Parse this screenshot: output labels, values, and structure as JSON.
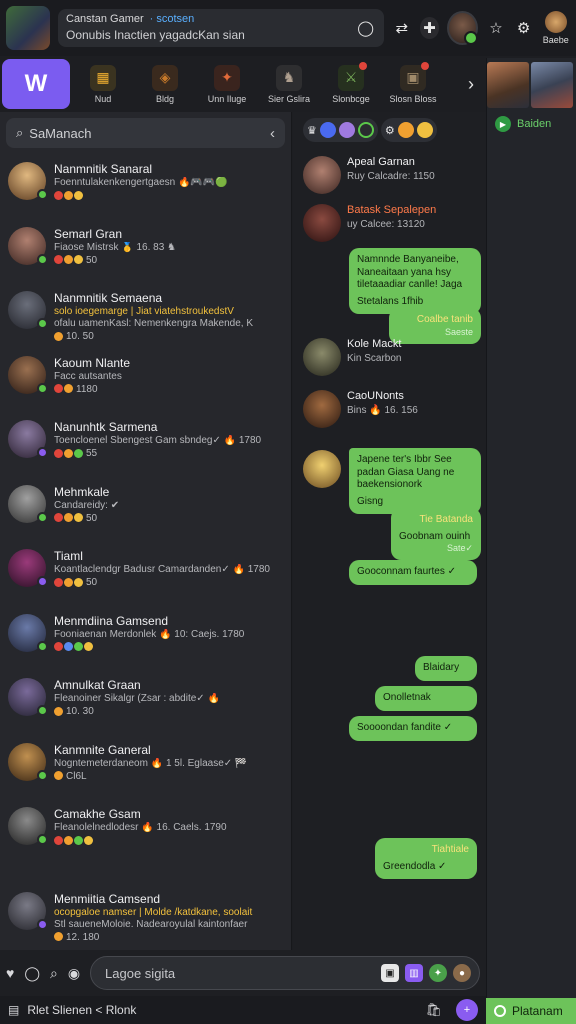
{
  "topbar": {
    "name": "Canstan Gamer",
    "name_sub": "· scotsen",
    "status": "Oonubis Inactien yagadcKan sian",
    "profile_label": "Baebe"
  },
  "games": [
    {
      "label": "Nud",
      "color": "#f0b030",
      "glyph": "▦",
      "dot": false
    },
    {
      "label": "Bldg",
      "color": "#c87a2a",
      "glyph": "◈",
      "dot": false
    },
    {
      "label": "Unn Iluge",
      "color": "#e06a3a",
      "glyph": "✦",
      "dot": false
    },
    {
      "label": "Sier Gslira",
      "color": "#8a8a8a",
      "glyph": "♞",
      "dot": false
    },
    {
      "label": "Slonbcge",
      "color": "#5a8a4a",
      "glyph": "⚔",
      "dot": true
    },
    {
      "label": "Slosn Bloss",
      "color": "#6a5a4a",
      "glyph": "▣",
      "dot": true
    }
  ],
  "preview_panel": {
    "status": "Baiden"
  },
  "search": {
    "placeholder": "SaManach"
  },
  "conversations": [
    {
      "name": "Nanmnitik Sanaral",
      "preview": "Foenntulakenkengertgaesn 🔥🎮🎮🟢",
      "meta": "",
      "gold": false,
      "av": "#c9a268",
      "on": "#5bc84a"
    },
    {
      "name": "Semarl Gran",
      "preview": "Fiaose Mistrsk 🥇 16. 83 ♞",
      "meta": "50",
      "gold": false,
      "av": "#7a5548",
      "on": "#5bc84a"
    },
    {
      "name": "Nanmnitik Semaena",
      "preview": "solo ioegemarge | Jiat viatehstroukedstV",
      "preview2": "ofalu uamenKasl: Nemenkengra Makende, K",
      "meta": "10. 50",
      "gold": true,
      "av": "#3a3c46",
      "on": "#5bc84a"
    },
    {
      "name": "Kaoum Nlante",
      "preview": "Facc autsantes",
      "meta": "1180",
      "gold": false,
      "av": "#4a3a30",
      "on": "#5bc84a"
    },
    {
      "name": "Nanunhtk Sarmena",
      "preview": "Toencloenel Sbengest Gam sbndeg✓ 🔥 1780",
      "meta": "55",
      "gold": false,
      "av": "#5a4a6a",
      "on": "#8a5cf0"
    },
    {
      "name": "Mehmkale",
      "preview": "Candareidy: ✔",
      "meta": "50",
      "gold": false,
      "av": "#6a6a6a",
      "on": "#5bc84a"
    },
    {
      "name": "Tiaml",
      "preview": "Koantlaclendgr Badusr Camardanden✓ 🔥 1780",
      "meta": "50",
      "gold": false,
      "av": "#5a2a4a",
      "on": "#8a5cf0"
    },
    {
      "name": "Menmdiina Gamsend",
      "preview": "Fooniaenan Merdonlek 🔥 10: Caejs. 1780",
      "meta": "",
      "gold": false,
      "av": "#3a4a6a",
      "on": "#5bc84a"
    },
    {
      "name": "Amnulkat Graan",
      "preview": "Fleanoiner Sikalgr (Zsar : abdite✓ 🔥",
      "meta": "10. 30",
      "gold": false,
      "av": "#4a3a5a",
      "on": "#5bc84a"
    },
    {
      "name": "Kanmnite Ganeral",
      "preview": "Nogntemeterdaneom 🔥 1 5l. Eglaase✓ 🏁",
      "meta": "Cl6L",
      "gold": false,
      "av": "#8a6a3a",
      "on": "#5bc84a"
    },
    {
      "name": "Camakhe Gsam",
      "preview": "Fleanolelnedlodesr 🔥 16. Caels. 1790",
      "meta": "",
      "gold": false,
      "av": "#3a3a3a",
      "on": "#5bc84a"
    },
    {
      "name": "Menmiitia Camsend",
      "preview": "ocopgaloe namser | Molde /katdkane, soolait",
      "preview2": "Stl saueneMoloie. Nadearoyulal kaintonfaer",
      "meta": "12. 180",
      "gold": true,
      "av": "#4a4a55",
      "on": "#8a5cf0"
    }
  ],
  "chat": {
    "messages": [
      {
        "name": "Apeal Garnan",
        "sub": "Ruy Calcadre: 1150",
        "orange": false,
        "av": "#6a4a40"
      },
      {
        "name": "Batask Sepalepen",
        "sub": "uy Calcee: 13120",
        "orange": true,
        "av": "#5a2a2a"
      },
      {
        "name": "Kole Mackt",
        "sub": "Kin Scarbon",
        "orange": false,
        "av": "#4a4a3a"
      },
      {
        "name": "CaoUNonts",
        "sub": "Bins 🔥 16. 156",
        "orange": false,
        "av": "#5a3a2a"
      }
    ],
    "bubbles": [
      {
        "text": "Namnnde Banyaneibe, Naneaitaan yana hsy tiletaaadiar canlle! Jaga",
        "text2": "Stetalans 1fhib"
      },
      {
        "text": "Coalbe tanib",
        "time": "Saeste"
      },
      {
        "text": "Japene ter's Ibbr See padan Giasa Uang ne baekensionork",
        "text2": "Gisng"
      },
      {
        "text": "Tie Batanda",
        "text2": "Goobnam ouinh",
        "time": "Sate✓"
      },
      {
        "text": "Gooconnam faurtes ✓"
      },
      {
        "text": "Blaidary"
      },
      {
        "text": "Onolletnak"
      },
      {
        "text": "Soooondan fandite ✓"
      },
      {
        "text": "Tiahtiale",
        "text2": "Greendodla ✓"
      }
    ]
  },
  "input": {
    "placeholder": "Lagoe sigita"
  },
  "footer": {
    "label": "Rlet Slienen < Rlonk"
  },
  "platform": {
    "label": "Platanam"
  }
}
